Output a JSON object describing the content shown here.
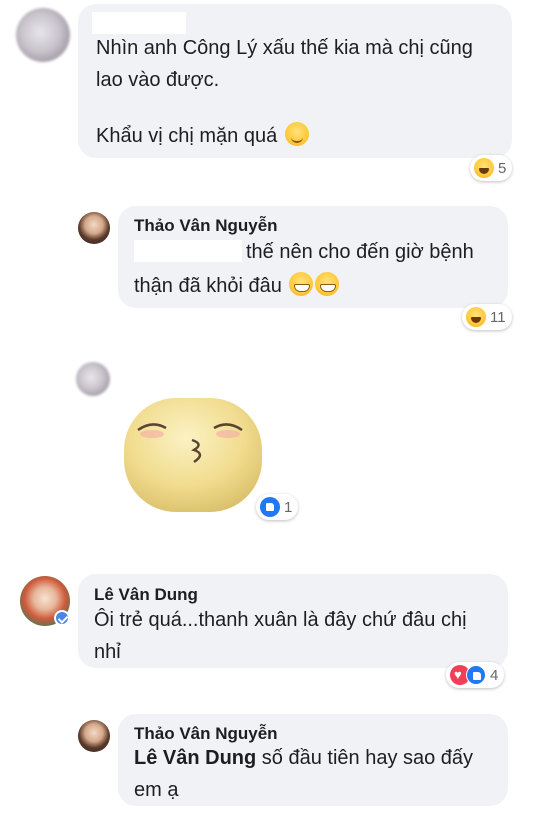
{
  "comments": [
    {
      "id": "c1",
      "author": "",
      "lines": [
        "Nhìn anh Công Lý xấu thế kia mà chị cũng",
        "lao vào được.",
        "",
        "Khẩu vị chị mặn quá"
      ],
      "reaction_count": "5",
      "reaction_types": [
        "haha-icon"
      ]
    },
    {
      "id": "c2",
      "author": "Thảo Vân Nguyễn",
      "lines": [
        "thế nên cho đến giờ bệnh",
        "thận đã khỏi đâu"
      ],
      "reaction_count": "11",
      "reaction_types": [
        "haha-icon"
      ]
    },
    {
      "id": "c3",
      "author": "",
      "sticker": "kissing-sticker",
      "reaction_count": "1",
      "reaction_types": [
        "like-icon"
      ]
    },
    {
      "id": "c4",
      "author": "Lê Vân Dung",
      "lines": [
        "Ôi trẻ quá...thanh xuân là đây chứ đâu chị",
        "nhỉ"
      ],
      "reaction_count": "4",
      "reaction_types": [
        "love-icon",
        "like-icon"
      ]
    },
    {
      "id": "c5",
      "author": "Thảo Vân Nguyễn",
      "mention": "Lê Vân Dung",
      "lines": [
        " số đầu tiên hay sao đấy",
        "em ạ"
      ]
    }
  ],
  "colors": {
    "bubble": "#f0f2f5",
    "like": "#2078f4",
    "love": "#f33e58",
    "haha": "#ffc93a"
  }
}
